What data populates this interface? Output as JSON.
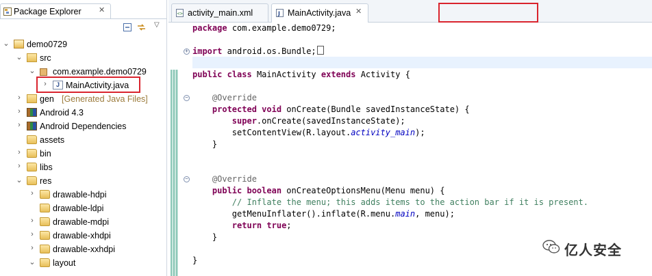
{
  "package_explorer": {
    "title": "Package Explorer",
    "tree": [
      {
        "label": "demo0729",
        "decoration": "",
        "icon": "project-icon",
        "arrow": "expanded",
        "indent": 0
      },
      {
        "label": "src",
        "decoration": "",
        "icon": "source-folder-icon",
        "arrow": "expanded",
        "indent": 1
      },
      {
        "label": "com.example.demo0729",
        "decoration": "",
        "icon": "package-icon",
        "arrow": "expanded",
        "indent": 2
      },
      {
        "label": "MainActivity.java",
        "decoration": "",
        "icon": "java-file-icon",
        "arrow": "collapsed",
        "indent": 3
      },
      {
        "label": "gen",
        "decoration": "[Generated Java Files]",
        "icon": "source-folder-icon",
        "arrow": "collapsed",
        "indent": 1
      },
      {
        "label": "Android 4.3",
        "decoration": "",
        "icon": "library-icon",
        "arrow": "collapsed",
        "indent": 1
      },
      {
        "label": "Android Dependencies",
        "decoration": "",
        "icon": "library-icon",
        "arrow": "collapsed",
        "indent": 1
      },
      {
        "label": "assets",
        "decoration": "",
        "icon": "folder-icon",
        "arrow": "none",
        "indent": 1
      },
      {
        "label": "bin",
        "decoration": "",
        "icon": "folder-icon",
        "arrow": "collapsed",
        "indent": 1
      },
      {
        "label": "libs",
        "decoration": "",
        "icon": "folder-icon",
        "arrow": "collapsed",
        "indent": 1
      },
      {
        "label": "res",
        "decoration": "",
        "icon": "folder-icon",
        "arrow": "expanded",
        "indent": 1
      },
      {
        "label": "drawable-hdpi",
        "decoration": "",
        "icon": "folder-icon",
        "arrow": "collapsed",
        "indent": 2
      },
      {
        "label": "drawable-ldpi",
        "decoration": "",
        "icon": "folder-icon",
        "arrow": "none",
        "indent": 2
      },
      {
        "label": "drawable-mdpi",
        "decoration": "",
        "icon": "folder-icon",
        "arrow": "collapsed",
        "indent": 2
      },
      {
        "label": "drawable-xhdpi",
        "decoration": "",
        "icon": "folder-icon",
        "arrow": "collapsed",
        "indent": 2
      },
      {
        "label": "drawable-xxhdpi",
        "decoration": "",
        "icon": "folder-icon",
        "arrow": "collapsed",
        "indent": 2
      },
      {
        "label": "layout",
        "decoration": "",
        "icon": "folder-icon",
        "arrow": "expanded",
        "indent": 2
      }
    ]
  },
  "editor": {
    "tabs": [
      {
        "label": "activity_main.xml",
        "active": false
      },
      {
        "label": "MainActivity.java",
        "active": true
      }
    ],
    "code_lines": [
      [
        [
          "kw",
          "package"
        ],
        [
          "",
          "com.example.demo0729;"
        ]
      ],
      [],
      [
        [
          "kw",
          "import"
        ],
        [
          "",
          "android.os.Bundle;"
        ]
      ],
      [],
      [
        [
          "kw",
          "public"
        ],
        [
          "",
          ""
        ],
        [
          "kw",
          "class"
        ],
        [
          "",
          "MainActivity"
        ],
        [
          "kw",
          "extends"
        ],
        [
          "",
          "Activity {"
        ]
      ],
      [],
      [
        [
          "an",
          "    @Override"
        ]
      ],
      [
        [
          "kw",
          "    protected"
        ],
        [
          "kw",
          "void"
        ],
        [
          "",
          "onCreate(Bundle savedInstanceState) {"
        ]
      ],
      [
        [
          "kw",
          "        super"
        ],
        [
          "",
          ".onCreate(savedInstanceState);"
        ]
      ],
      [
        [
          "",
          "        setContentView(R.layout."
        ],
        [
          "fld",
          "activity_main"
        ],
        [
          "",
          ");"
        ]
      ],
      [
        [
          "",
          "    }"
        ]
      ],
      [],
      [],
      [
        [
          "an",
          "    @Override"
        ]
      ],
      [
        [
          "kw",
          "    public"
        ],
        [
          "kw",
          "boolean"
        ],
        [
          "",
          "onCreateOptionsMenu(Menu menu) {"
        ]
      ],
      [
        [
          "cm",
          "        // Inflate the menu; this adds items to the action bar if it is present."
        ]
      ],
      [
        [
          "",
          "        getMenuInflater().inflate(R.menu."
        ],
        [
          "fld",
          "main"
        ],
        [
          "",
          ", menu);"
        ]
      ],
      [
        [
          "kw",
          "        return"
        ],
        [
          "kw",
          "true"
        ],
        [
          "",
          ";"
        ]
      ],
      [
        [
          "",
          "    }"
        ]
      ],
      [],
      [
        [
          "",
          "}"
        ]
      ]
    ]
  },
  "watermark": {
    "text": "亿人安全"
  },
  "colors": {
    "highlight_box": "#d9232d",
    "keyword": "#7f0055",
    "comment": "#3f7f5f",
    "field": "#0000c0"
  }
}
